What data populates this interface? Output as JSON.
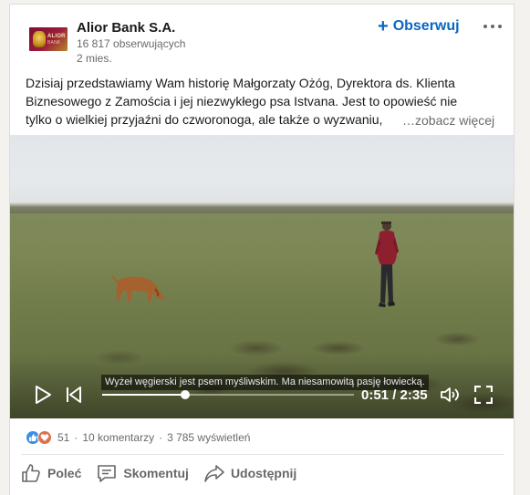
{
  "post": {
    "company_name": "Alior Bank S.A.",
    "followers": "16 817 obserwujących",
    "posted": "2 mies.",
    "logo_text": "ALIOR",
    "logo_subtext": "BANK",
    "follow_label": "Obserwuj",
    "text_lines": [
      "Dzisiaj przedstawiamy Wam historię Małgorzaty Ożóg, Dyrektora ds. Klienta",
      "Biznesowego z Zamościa i jej niezwykłego psa Istvana. Jest to opowieść nie",
      "tylko o wielkiej przyjaźni do czworonoga, ale także o wyzwaniu,"
    ],
    "see_more": "…zobacz więcej"
  },
  "video": {
    "caption": "Wyżeł węgierski jest psem myśliwskim. Ma niesamowitą pasję łowiecką.",
    "timecode": "0:51 / 2:35",
    "progress": 0.33
  },
  "social": {
    "reactions": "51",
    "comments": "10 komentarzy",
    "views": "3 785 wyświetleń",
    "separator": "·"
  },
  "actions": {
    "like": "Poleć",
    "comment": "Skomentuj",
    "share": "Udostępnij"
  },
  "colors": {
    "accent": "#0a66c2",
    "like_blue": "#378fe9",
    "love_red": "#df704d"
  }
}
